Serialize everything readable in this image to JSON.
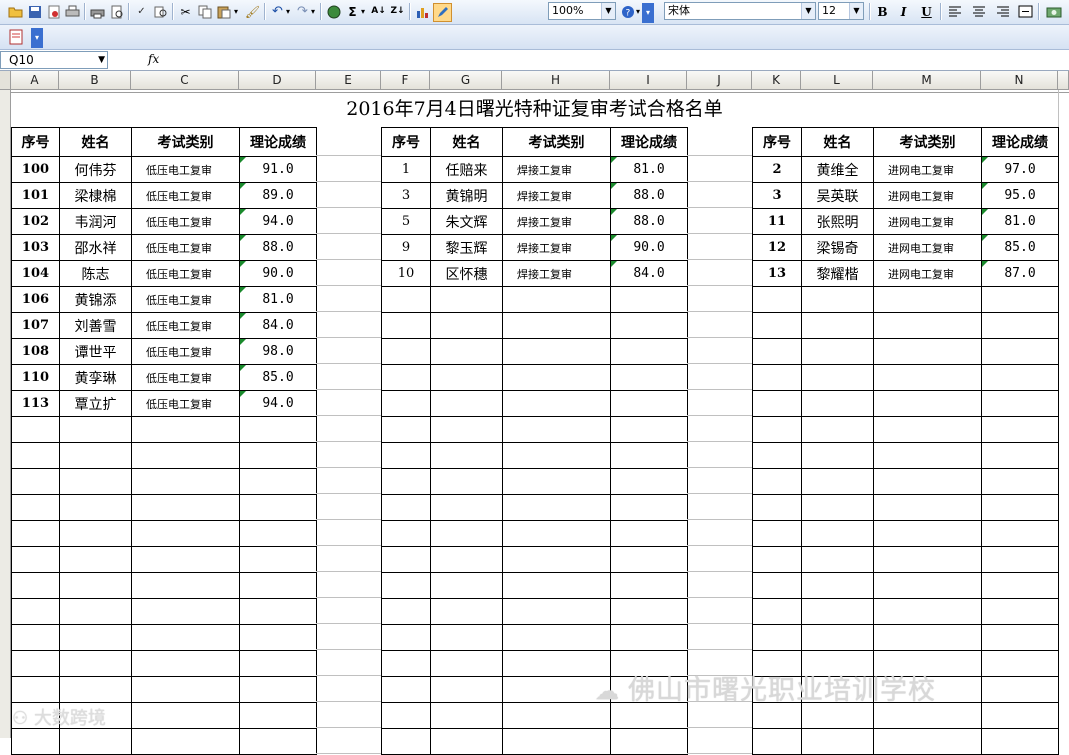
{
  "toolbar": {
    "zoom": "100%",
    "font": "宋体",
    "size": "12",
    "bold": "B",
    "italic": "I",
    "underline": "U",
    "sum": "Σ"
  },
  "formula_bar": {
    "cell_ref": "Q10",
    "fx": "fx",
    "content": ""
  },
  "columns": [
    "A",
    "B",
    "C",
    "D",
    "E",
    "F",
    "G",
    "H",
    "I",
    "J",
    "K",
    "L",
    "M",
    "N"
  ],
  "title": "2016年7月4日曙光特种证复审考试合格名单",
  "headers": [
    "序号",
    "姓名",
    "考试类别",
    "理论成绩"
  ],
  "block1": [
    {
      "no": "100",
      "name": "何伟芬",
      "type": "低压电工复审",
      "score": "91.0"
    },
    {
      "no": "101",
      "name": "梁棣棉",
      "type": "低压电工复审",
      "score": "89.0"
    },
    {
      "no": "102",
      "name": "韦润河",
      "type": "低压电工复审",
      "score": "94.0"
    },
    {
      "no": "103",
      "name": "邵水祥",
      "type": "低压电工复审",
      "score": "88.0"
    },
    {
      "no": "104",
      "name": "陈志",
      "type": "低压电工复审",
      "score": "90.0"
    },
    {
      "no": "106",
      "name": "黄锦添",
      "type": "低压电工复审",
      "score": "81.0"
    },
    {
      "no": "107",
      "name": "刘善雪",
      "type": "低压电工复审",
      "score": "84.0"
    },
    {
      "no": "108",
      "name": "谭世平",
      "type": "低压电工复审",
      "score": "98.0"
    },
    {
      "no": "110",
      "name": "黄孪琳",
      "type": "低压电工复审",
      "score": "85.0"
    },
    {
      "no": "113",
      "name": "覃立扩",
      "type": "低压电工复审",
      "score": "94.0"
    }
  ],
  "block2": [
    {
      "no": "1",
      "name": "任赔来",
      "type": "焊接工复审",
      "score": "81.0"
    },
    {
      "no": "3",
      "name": "黄锦明",
      "type": "焊接工复审",
      "score": "88.0"
    },
    {
      "no": "5",
      "name": "朱文辉",
      "type": "焊接工复审",
      "score": "88.0"
    },
    {
      "no": "9",
      "name": "黎玉辉",
      "type": "焊接工复审",
      "score": "90.0"
    },
    {
      "no": "10",
      "name": "区怀穗",
      "type": "焊接工复审",
      "score": "84.0"
    }
  ],
  "block3": [
    {
      "no": "2",
      "name": "黄维全",
      "type": "进网电工复审",
      "score": "97.0"
    },
    {
      "no": "3",
      "name": "吴英联",
      "type": "进网电工复审",
      "score": "95.0"
    },
    {
      "no": "11",
      "name": "张熙明",
      "type": "进网电工复审",
      "score": "81.0"
    },
    {
      "no": "12",
      "name": "梁锡奇",
      "type": "进网电工复审",
      "score": "85.0"
    },
    {
      "no": "13",
      "name": "黎耀楷",
      "type": "进网电工复审",
      "score": "87.0"
    }
  ],
  "watermarks": {
    "school": "佛山市曙光职业培训学校",
    "logo_text": "大数跨境"
  },
  "colors": {
    "toolbar": "#d8e4f4",
    "header_bg": "#e4e2da",
    "grid": "#c0c0c0",
    "marker": "#1a8a2c"
  }
}
